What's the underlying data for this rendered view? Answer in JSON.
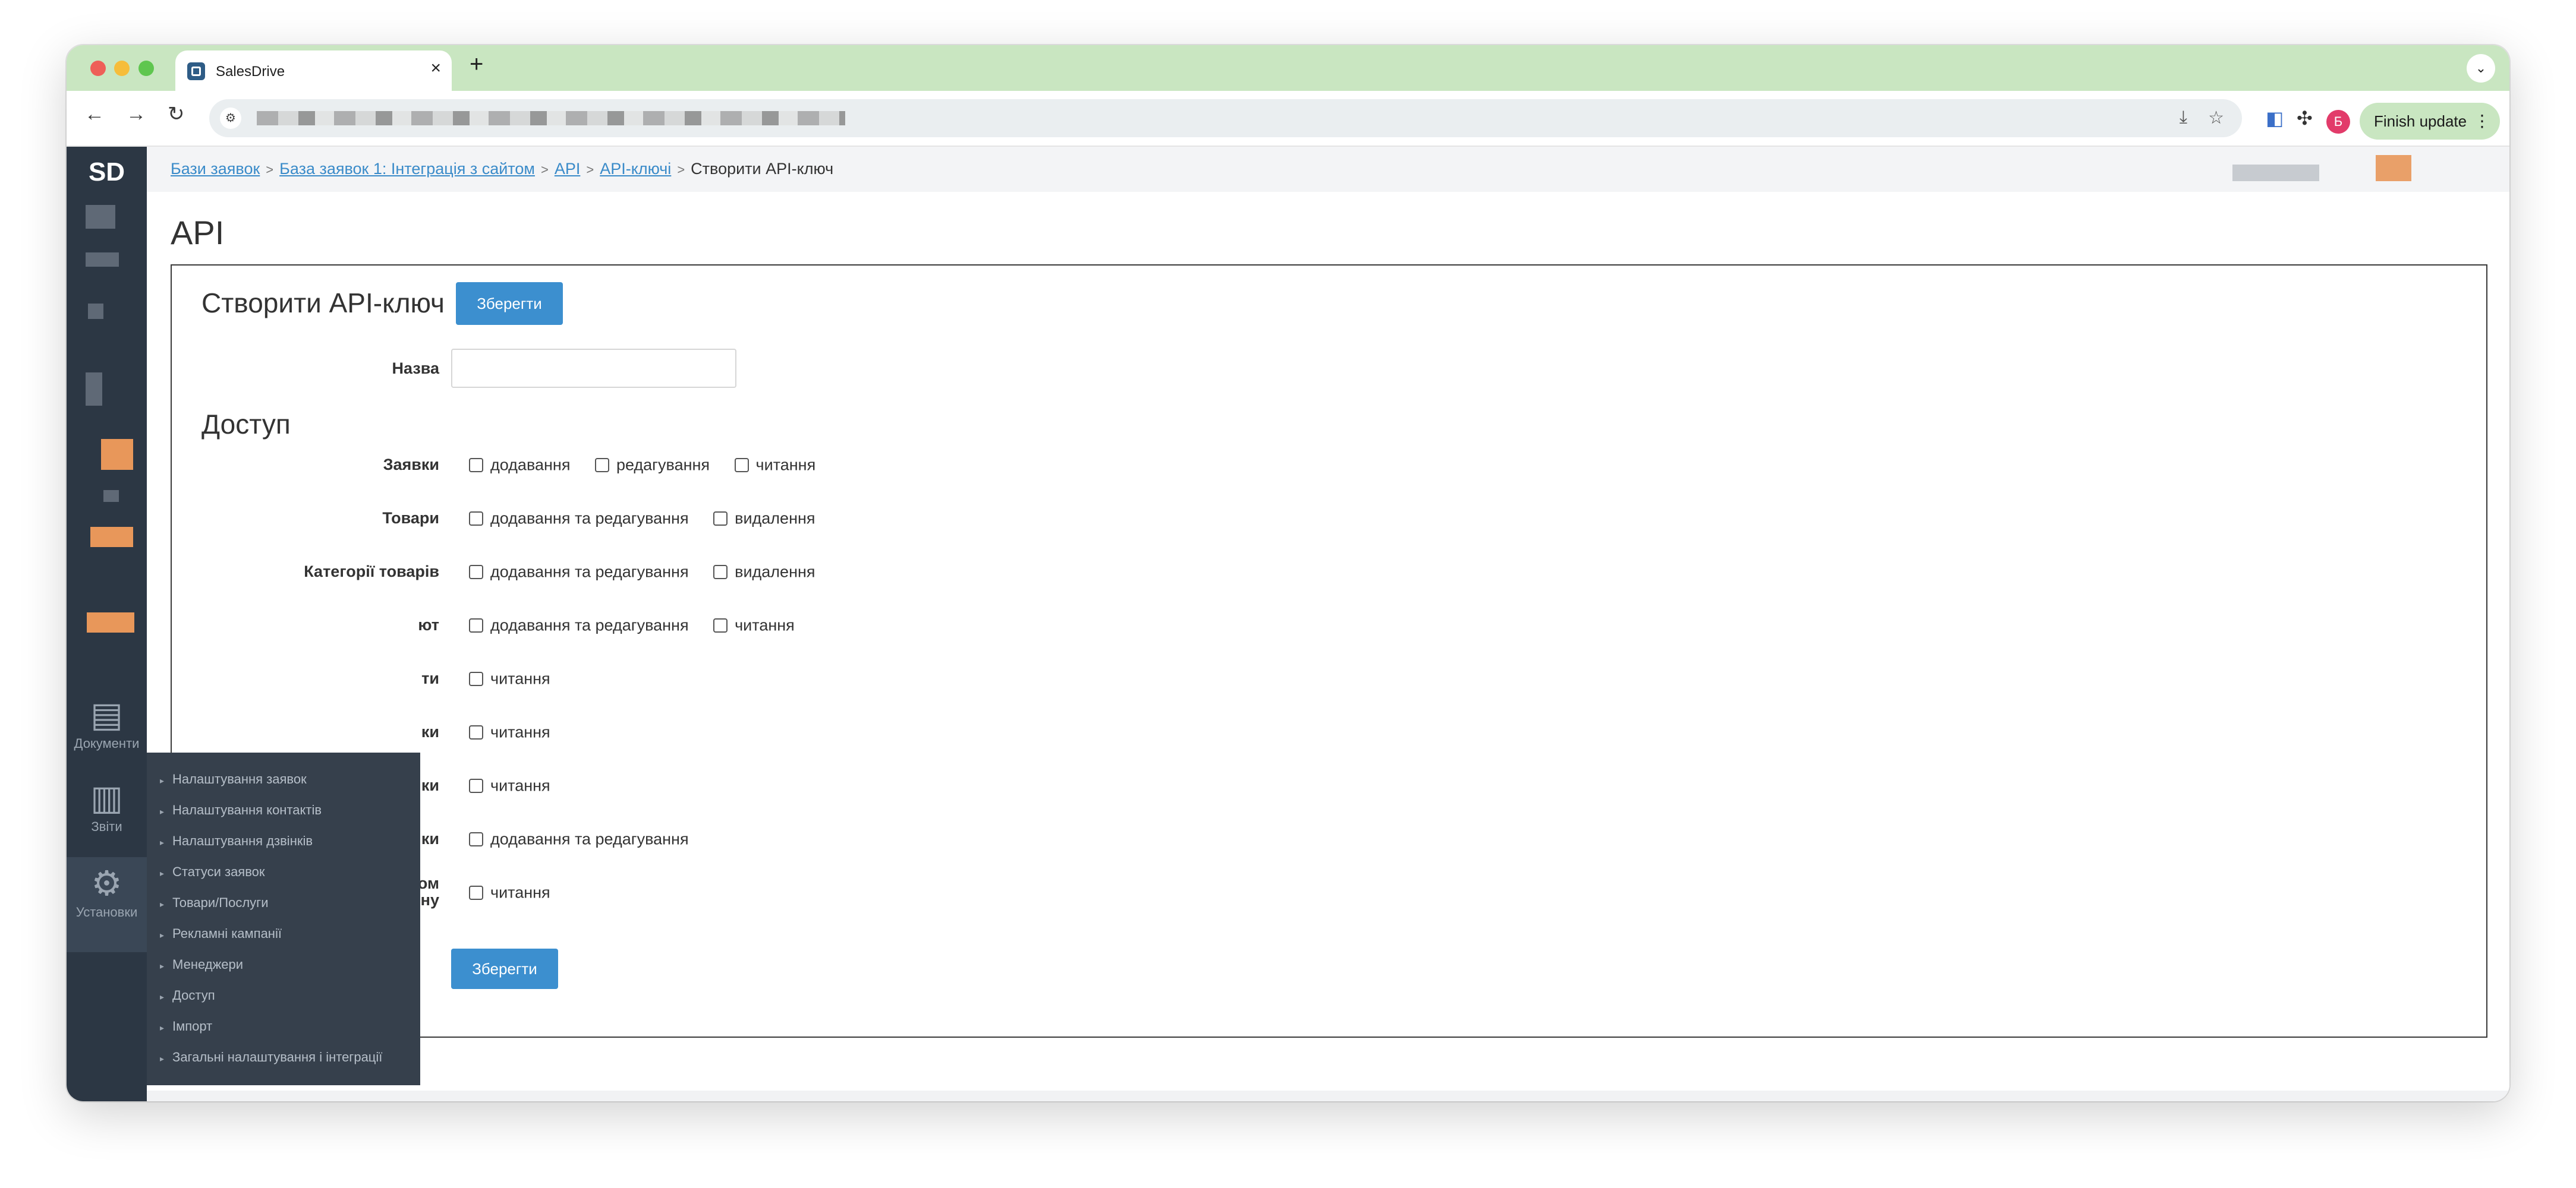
{
  "browser": {
    "tab_title": "SalesDrive",
    "tab_close": "×",
    "new_tab": "+",
    "menu": "⌄",
    "back": "←",
    "forward": "→",
    "reload": "↻",
    "finish_update": "Finish update",
    "profile_initial": "Б"
  },
  "rail": {
    "logo": "SD",
    "items": [
      {
        "label": "Документи",
        "icon": "document-icon"
      },
      {
        "label": "Звіти",
        "icon": "bar-chart-icon"
      },
      {
        "label": "Установки",
        "icon": "gear-icon"
      }
    ]
  },
  "breadcrumb": [
    {
      "label": "Бази заявок",
      "link": true
    },
    {
      "label": "База заявок 1: Інтеграція з сайтом",
      "link": true
    },
    {
      "label": "API",
      "link": true
    },
    {
      "label": "API-ключі",
      "link": true
    },
    {
      "label": "Створити API-ключ",
      "link": false
    }
  ],
  "page": {
    "title": "API",
    "panel_title": "Створити API-ключ",
    "save_label": "Зберегти",
    "name_label": "Назва",
    "name_value": "",
    "access_title": "Доступ"
  },
  "permissions": [
    {
      "label": "Заявки",
      "options": [
        "додавання",
        "редагування",
        "читання"
      ]
    },
    {
      "label": "Товари",
      "options": [
        "додавання та редагування",
        "видалення"
      ]
    },
    {
      "label": "Категорії товарів",
      "options": [
        "додавання та редагування",
        "видалення"
      ]
    },
    {
      "label": "ют",
      "options": [
        "додавання та редагування",
        "читання"
      ]
    },
    {
      "label": "ти",
      "options": [
        "читання"
      ]
    },
    {
      "label": "ки",
      "options": [
        "читання"
      ]
    },
    {
      "label": "ки",
      "options": [
        "читання"
      ]
    },
    {
      "label": "ки",
      "options": [
        "додавання та редагування"
      ]
    },
    {
      "label": "ом\nну",
      "options": [
        "читання"
      ]
    }
  ],
  "flyout": [
    "Налаштування заявок",
    "Налаштування контактів",
    "Налаштування дзвінків",
    "Статуси заявок",
    "Товари/Послуги",
    "Рекламні кампанії",
    "Менеджери",
    "Доступ",
    "Імпорт",
    "Загальні налаштування і інтеграції"
  ]
}
